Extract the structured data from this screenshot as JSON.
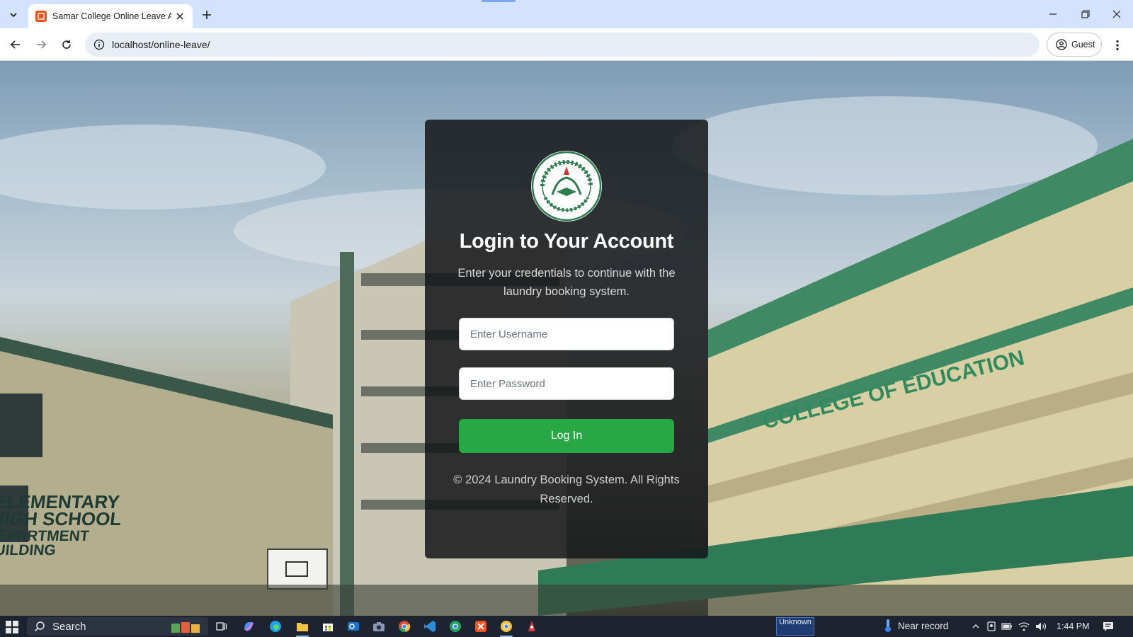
{
  "browser": {
    "tab_title": "Samar College Online Leave Ap",
    "url": "localhost/online-leave/",
    "profile_label": "Guest"
  },
  "login": {
    "logo_text": "SAMAR COLLEGE · CATBALOGAN",
    "title": "Login to Your Account",
    "subtitle": "Enter your credentials to continue with the laundry booking system.",
    "username_placeholder": "Enter Username",
    "password_placeholder": "Enter Password",
    "button_label": "Log In",
    "footer": "© 2024 Laundry Booking System. All Rights Reserved.",
    "accent_color": "#28a745"
  },
  "background": {
    "signs": [
      "ELEMENTARY",
      "HIGH SCHOOL",
      "DEPARTMENT",
      "BUILDING",
      "COLLEGE OF EDUCATION"
    ]
  },
  "taskbar": {
    "search_label": "Search",
    "notification_text": "Unknown",
    "weather_text": "Near record",
    "time": "1:44 PM"
  }
}
